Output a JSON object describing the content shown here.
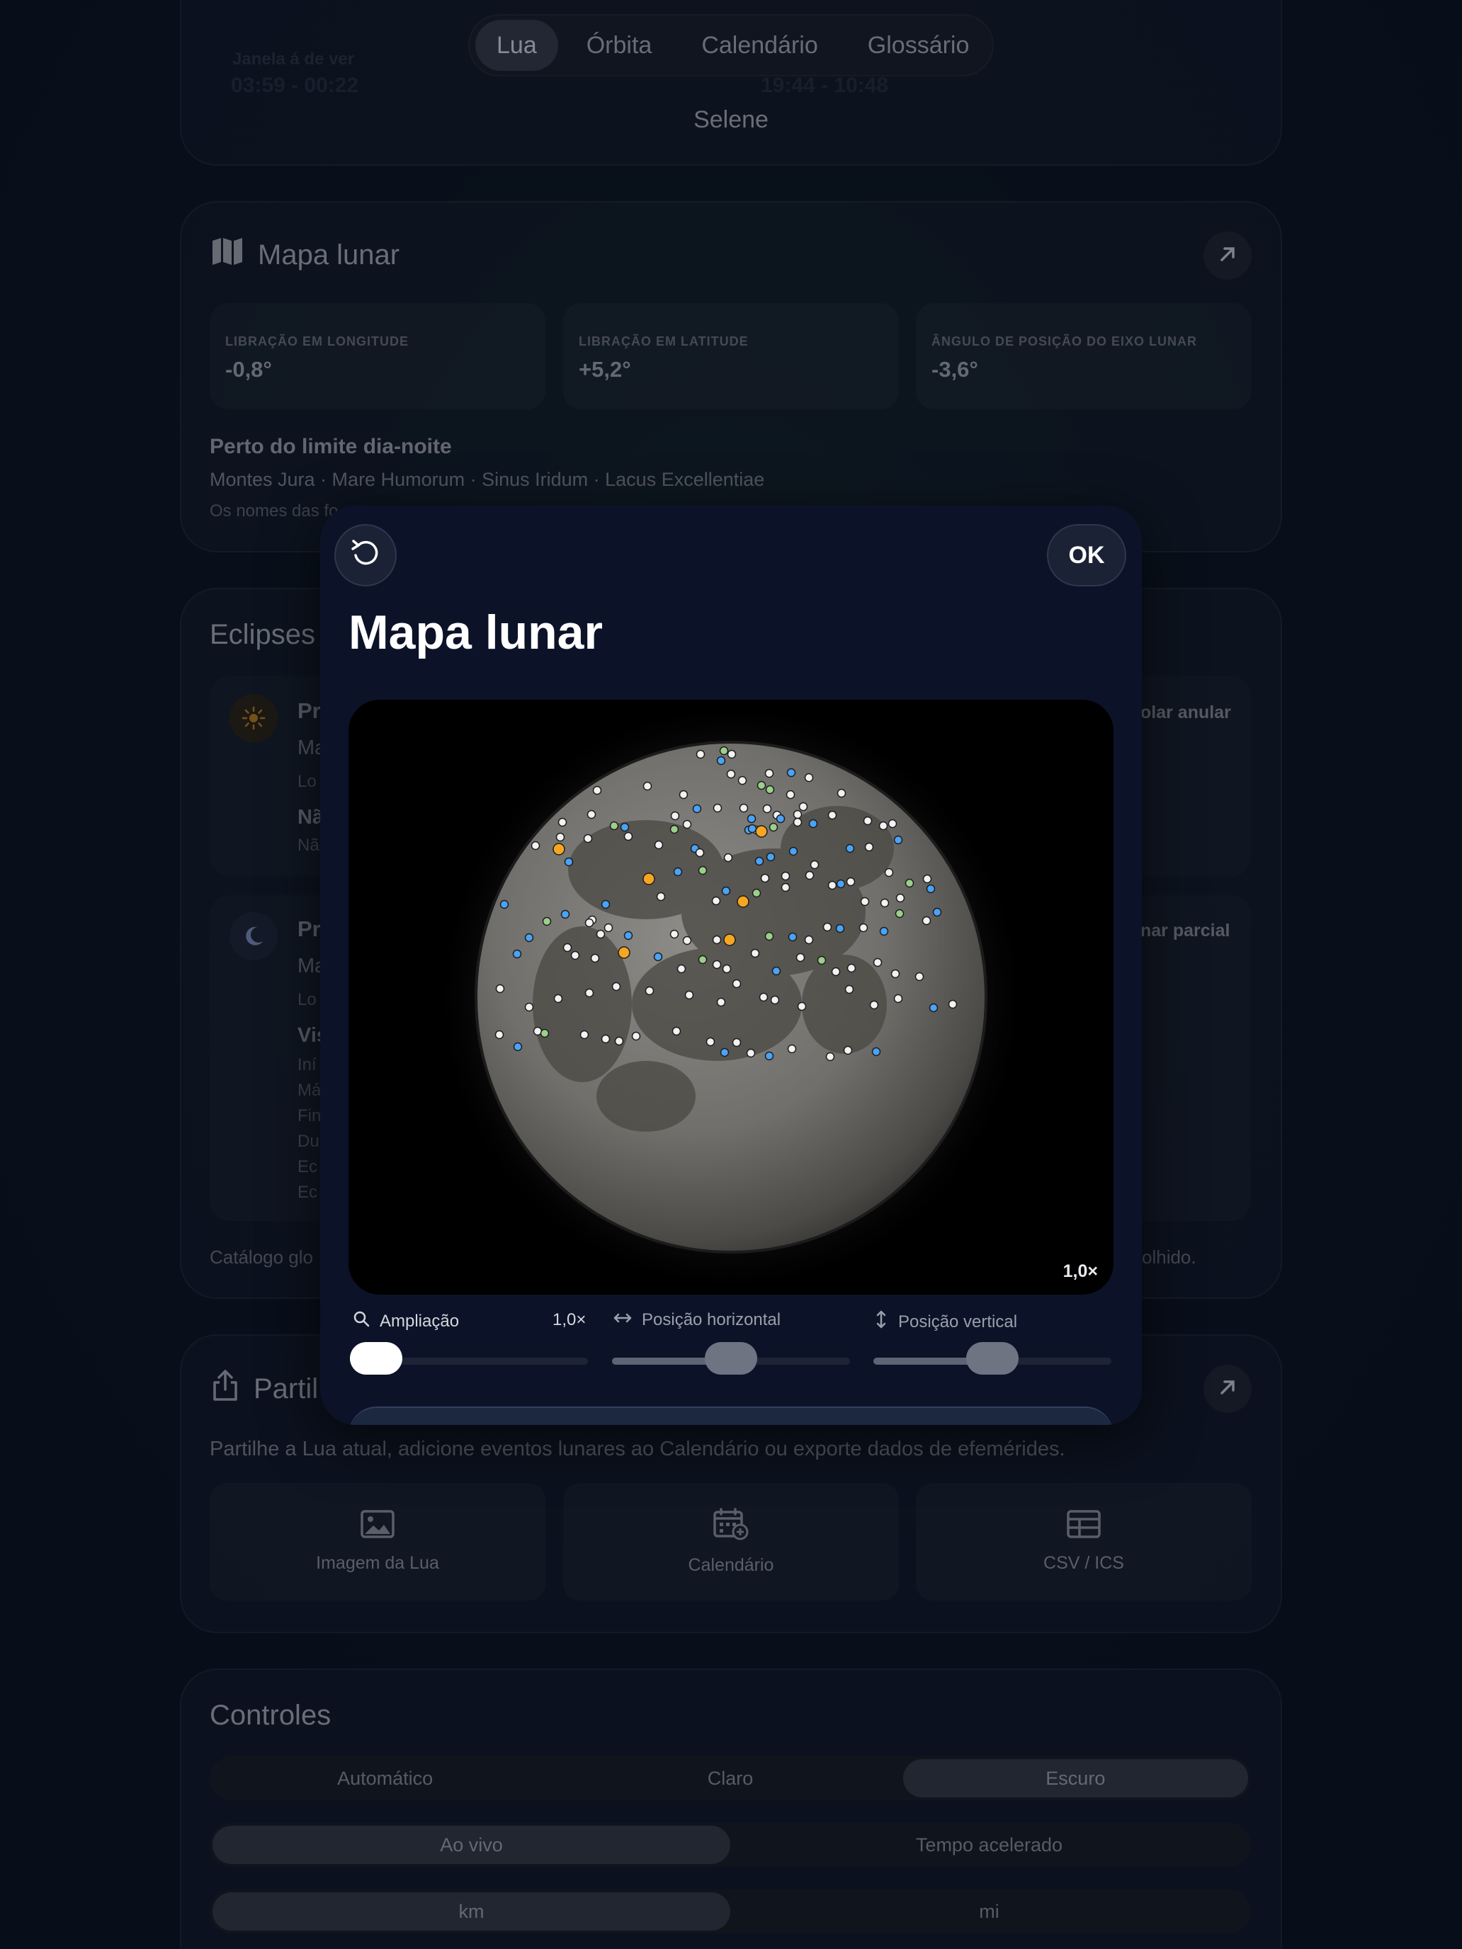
{
  "nav": {
    "tabs": [
      {
        "label": "Lua",
        "active": true
      },
      {
        "label": "Órbita",
        "active": false
      },
      {
        "label": "Calendário",
        "active": false
      },
      {
        "label": "Glossário",
        "active": false
      }
    ],
    "app_name": "Selene"
  },
  "top_card": {
    "left_label": "Janela á de ver",
    "left_value": "03:59 - 00:22",
    "right_value": "19:44 - 10:48"
  },
  "lunar_map_card": {
    "title": "Mapa lunar",
    "stats": [
      {
        "label": "LIBRAÇÃO EM LONGITUDE",
        "value": "-0,8°"
      },
      {
        "label": "LIBRAÇÃO EM LATITUDE",
        "value": "+5,2°"
      },
      {
        "label": "ÂNGULO DE POSIÇÃO DO EIXO LUNAR",
        "value": "-3,6°"
      }
    ],
    "terminator_heading": "Perto do limite dia-noite",
    "terminator_features": "Montes Jura · Mare Humorum · Sinus Iridum · Lacus Excellentiae",
    "note": "Os nomes das fo"
  },
  "eclipses_card": {
    "title": "Eclipses",
    "solar": {
      "title_fragment": "Pr",
      "type": "olar anular",
      "line1": "Ma",
      "line2": "Lo",
      "line3": "Nã",
      "line4": "Nã"
    },
    "lunar": {
      "title_fragment": "Pr",
      "type": "nar parcial",
      "line1": "Ma",
      "line2": "Lo",
      "line3": "Vis",
      "details": [
        "Iní",
        "Má",
        "Fin",
        "Du",
        "Ec",
        "Ec"
      ]
    },
    "footer_left": "Catálogo glo",
    "footer_right": "olhido."
  },
  "share_card": {
    "title": "Partil",
    "description": "Partilhe a Lua atual, adicione eventos lunares ao Calendário ou exporte dados de efemérides.",
    "items": [
      {
        "label": "Imagem da Lua",
        "icon": "image-icon"
      },
      {
        "label": "Calendário",
        "icon": "calendar-add-icon"
      },
      {
        "label": "CSV / ICS",
        "icon": "table-icon"
      }
    ]
  },
  "controls_card": {
    "title": "Controles",
    "theme": {
      "options": [
        "Automático",
        "Claro",
        "Escuro"
      ],
      "selected": "Escuro"
    },
    "time": {
      "options": [
        "Ao vivo",
        "Tempo acelerado"
      ],
      "selected": "Ao vivo"
    },
    "units": {
      "options": [
        "km",
        "mi"
      ],
      "selected": "km"
    }
  },
  "modal": {
    "title": "Mapa lunar",
    "ok_label": "OK",
    "zoom_badge": "1,0×",
    "zoom": {
      "label": "Ampliação",
      "value_text": "1,0×",
      "fraction": 0.0
    },
    "horizontal": {
      "label": "Posição horizontal",
      "fraction": 0.5
    },
    "vertical": {
      "label": "Posição vertical",
      "fraction": 0.5
    },
    "colors": {
      "white_marker": "#f2f2f2",
      "blue_marker": "#4aa3f5",
      "green_marker": "#9bd08a",
      "orange_marker": "#f5a623"
    }
  }
}
